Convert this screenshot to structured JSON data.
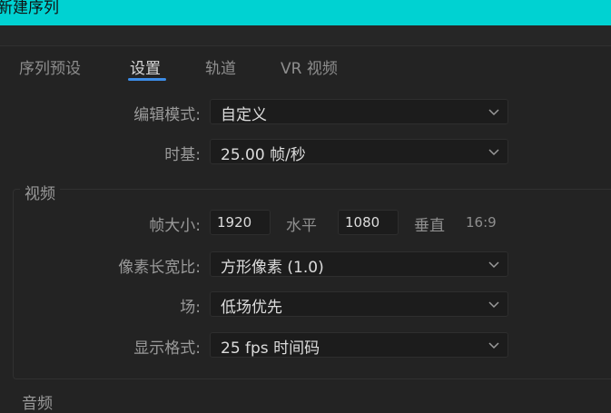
{
  "window": {
    "title": "新建序列"
  },
  "tabs": [
    {
      "label": "序列预设",
      "active": false
    },
    {
      "label": "设置",
      "active": true
    },
    {
      "label": "轨道",
      "active": false
    },
    {
      "label": "VR 视频",
      "active": false
    }
  ],
  "settings": {
    "edit_mode": {
      "label": "编辑模式:",
      "value": "自定义"
    },
    "timebase": {
      "label": "时基:",
      "value": "25.00  帧/秒"
    }
  },
  "video": {
    "title": "视频",
    "frame_size": {
      "label": "帧大小:",
      "width": "1920",
      "horizontal_label": "水平",
      "height": "1080",
      "vertical_label": "垂直",
      "aspect": "16:9"
    },
    "pixel_aspect": {
      "label": "像素长宽比:",
      "value": "方形像素 (1.0)"
    },
    "fields": {
      "label": "场:",
      "value": "低场优先"
    },
    "display_format": {
      "label": "显示格式:",
      "value": "25 fps 时间码"
    }
  },
  "audio": {
    "title": "音频"
  },
  "colors": {
    "titlebar": "#00d2d2",
    "background": "#232323",
    "accent": "#3c8ce6"
  }
}
